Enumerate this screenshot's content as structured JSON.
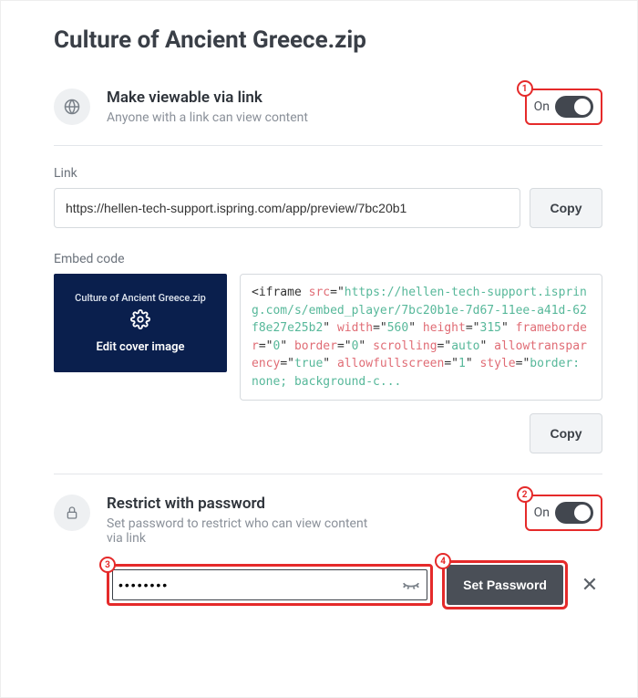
{
  "title": "Culture of Ancient Greece.zip",
  "viewable": {
    "heading": "Make viewable via link",
    "sub": "Anyone with a link can view content",
    "toggle_text": "On",
    "callout": "1"
  },
  "link": {
    "label": "Link",
    "value": "https://hellen-tech-support.ispring.com/app/preview/7bc20b1",
    "copy": "Copy"
  },
  "embed": {
    "label": "Embed code",
    "cover_filename": "Culture of Ancient Greece.zip",
    "cover_action": "Edit cover image",
    "copy": "Copy",
    "code": {
      "src": "https://hellen-tech-support.ispring.com/s/embed_player/7bc20b1e-7d67-11ee-a41d-62f8e27e25b2",
      "width": "560",
      "height": "315",
      "frameborder": "0",
      "border": "0",
      "scrolling": "auto",
      "allowtransparency": "true",
      "allowfullscreen": "1",
      "style_trunc": "border: none; background-c..."
    }
  },
  "restrict": {
    "heading": "Restrict with password",
    "sub": "Set password to restrict who can view content via link",
    "toggle_text": "On",
    "callout": "2",
    "input_callout": "3",
    "button_callout": "4",
    "password_mask": "••••••••",
    "button": "Set Password"
  }
}
